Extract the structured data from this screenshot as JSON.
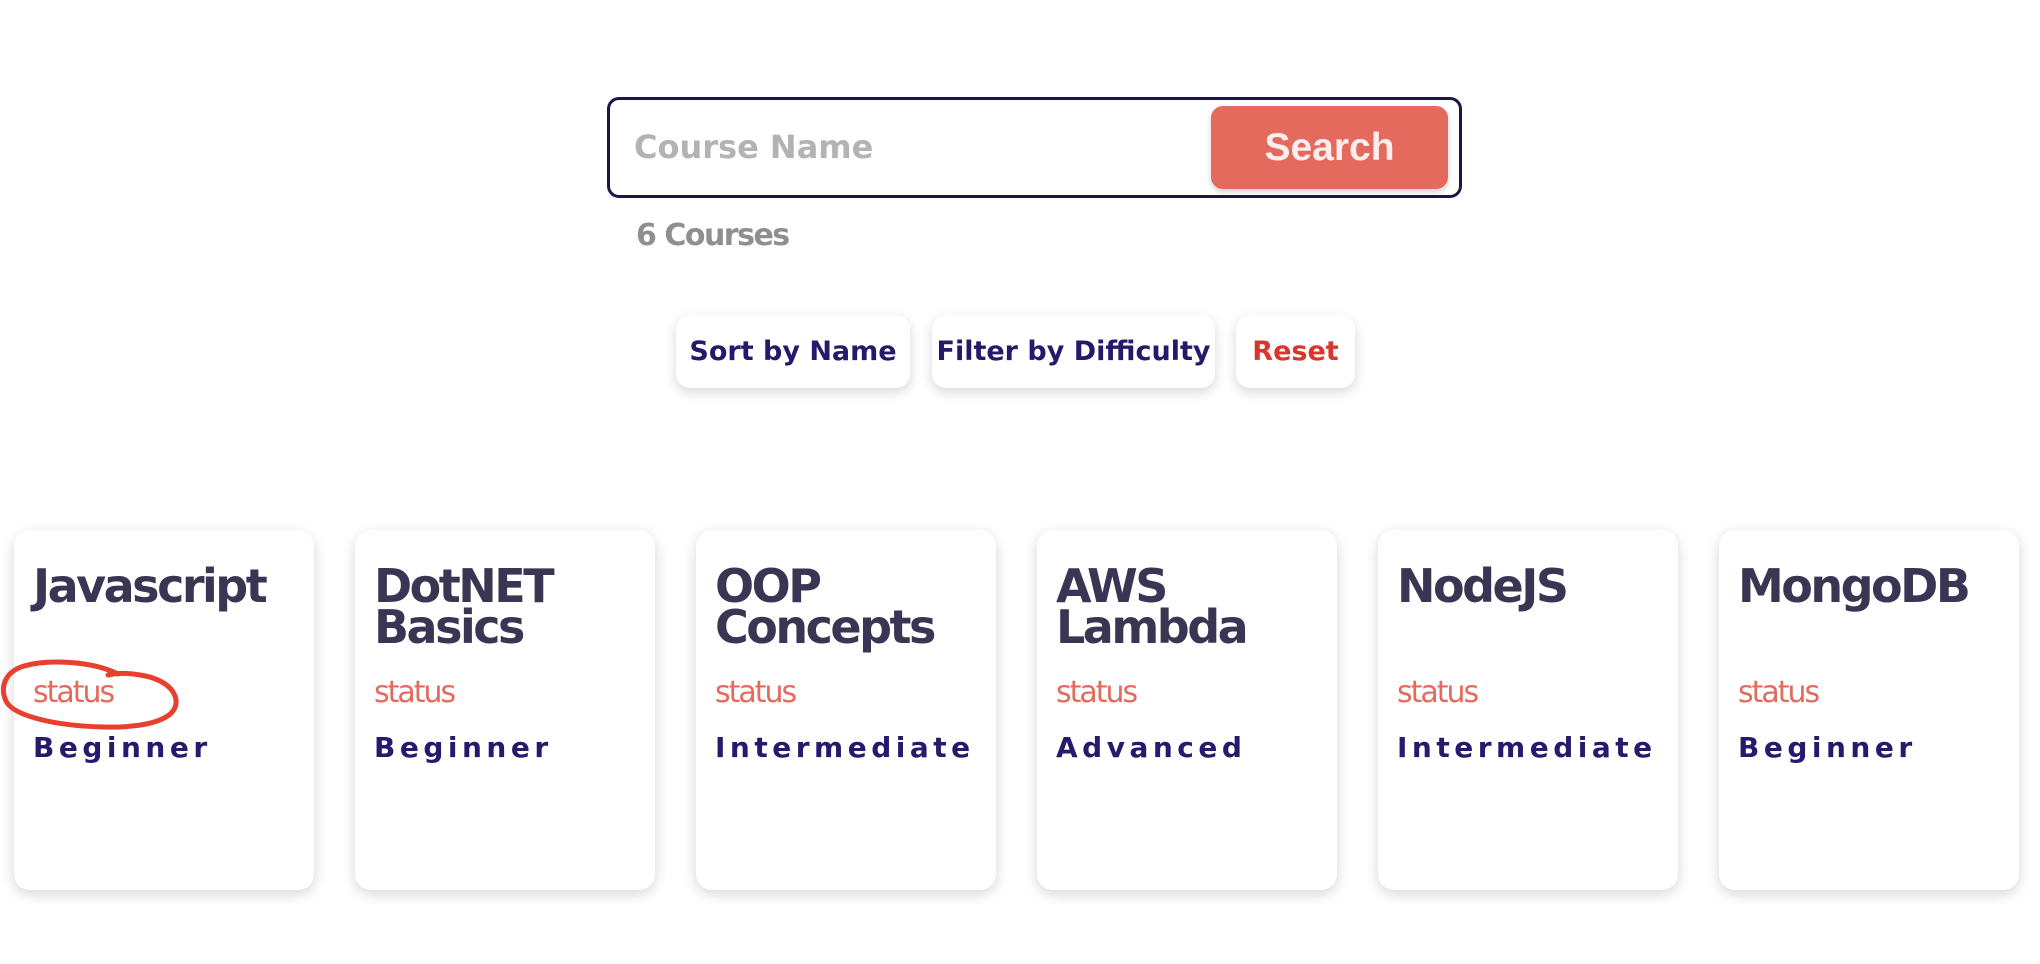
{
  "search": {
    "placeholder": "Course Name",
    "button_label": "Search"
  },
  "course_count": "6 Courses",
  "controls": {
    "sort_label": "Sort by Name",
    "filter_label": "Filter by Difficulty",
    "reset_label": "Reset"
  },
  "courses": [
    {
      "title": "Javascript",
      "status": "status",
      "level": "Beginner"
    },
    {
      "title": "DotNET Basics",
      "status": "status",
      "level": "Beginner"
    },
    {
      "title": "OOP Concepts",
      "status": "status",
      "level": "Intermediate"
    },
    {
      "title": "AWS Lambda",
      "status": "status",
      "level": "Advanced"
    },
    {
      "title": "NodeJS",
      "status": "status",
      "level": "Intermediate"
    },
    {
      "title": "MongoDB",
      "status": "status",
      "level": "Beginner"
    }
  ],
  "colors": {
    "accent": "#e56a5e",
    "brand_dark": "#24196a",
    "reset": "#d9362b",
    "annotation": "#e8402f"
  }
}
